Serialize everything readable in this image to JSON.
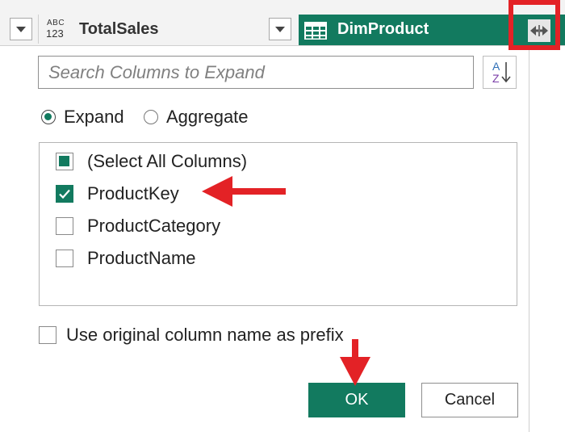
{
  "header": {
    "type_icon_top": "ABC",
    "type_icon_bottom": "123",
    "totalsales_column": "TotalSales",
    "dim_column": "DimProduct",
    "dim_column_color": "#127a5f"
  },
  "dialog": {
    "search_placeholder": "Search Columns to Expand",
    "sort_icon": "sort-az-icon",
    "radio_options": [
      {
        "label": "Expand",
        "selected": true
      },
      {
        "label": "Aggregate",
        "selected": false
      }
    ],
    "columns": [
      {
        "label": "(Select All Columns)",
        "state": "partial"
      },
      {
        "label": "ProductKey",
        "state": "checked"
      },
      {
        "label": "ProductCategory",
        "state": "unchecked"
      },
      {
        "label": "ProductName",
        "state": "unchecked"
      }
    ],
    "prefix_label": "Use original column name as prefix",
    "prefix_checked": false,
    "ok_label": "OK",
    "cancel_label": "Cancel"
  },
  "annotations": {
    "highlight_color": "#e32226"
  }
}
